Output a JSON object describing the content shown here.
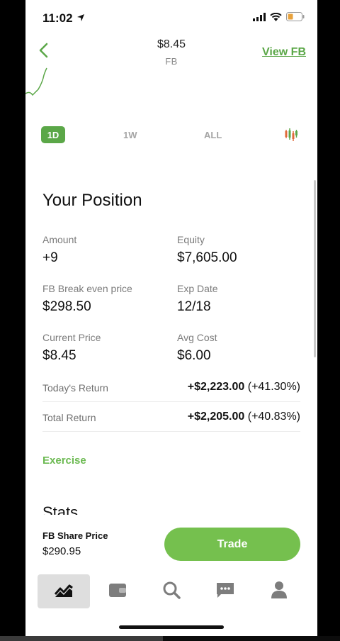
{
  "status_bar": {
    "time": "11:02"
  },
  "header": {
    "price": "$8.45",
    "ticker": "FB",
    "view_link": "View FB"
  },
  "ranges": {
    "day": "1D",
    "week": "1W",
    "all": "ALL"
  },
  "position": {
    "title": "Your Position",
    "fields": [
      {
        "label": "Amount",
        "value": "+9"
      },
      {
        "label": "Equity",
        "value": "$7,605.00"
      },
      {
        "label": "FB Break even price",
        "value": "$298.50"
      },
      {
        "label": "Exp Date",
        "value": "12/18"
      },
      {
        "label": "Current Price",
        "value": "$8.45"
      },
      {
        "label": "Avg Cost",
        "value": "$6.00"
      }
    ],
    "todays_return": {
      "label": "Today's Return",
      "amount": "+$2,223.00",
      "percent": "(+41.30%)"
    },
    "total_return": {
      "label": "Total Return",
      "amount": "+$2,205.00",
      "percent": "(+40.83%)"
    },
    "exercise_label": "Exercise"
  },
  "stats": {
    "title": "Stats"
  },
  "footer": {
    "share_label": "FB Share Price",
    "share_value": "$290.95",
    "trade_label": "Trade"
  },
  "colors": {
    "accent": "#5ba748",
    "trade": "#75c04e",
    "icon_gray": "#7d7d7d"
  },
  "tabs": [
    {
      "icon": "chart-icon",
      "active": true
    },
    {
      "icon": "wallet-icon",
      "active": false
    },
    {
      "icon": "search-icon",
      "active": false
    },
    {
      "icon": "messages-icon",
      "active": false
    },
    {
      "icon": "profile-icon",
      "active": false
    }
  ]
}
